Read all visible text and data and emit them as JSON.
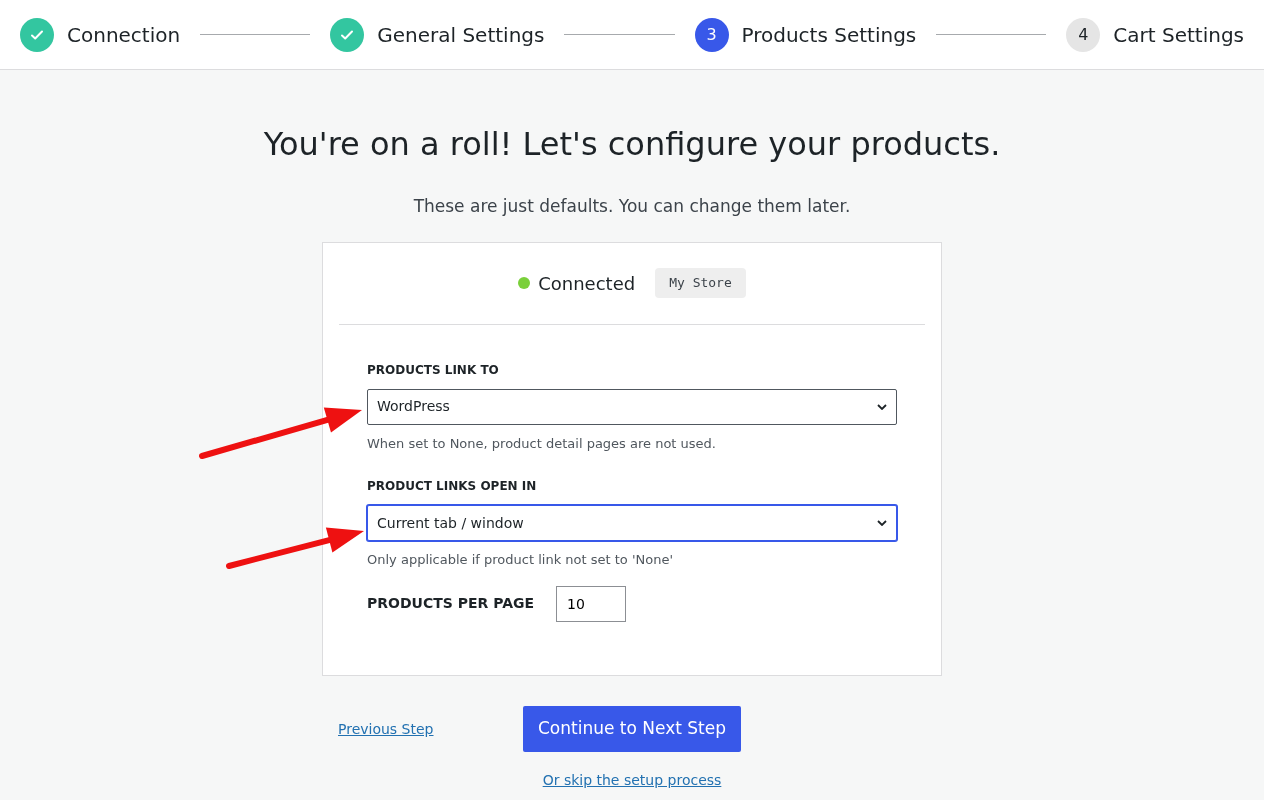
{
  "steps": [
    {
      "label": "Connection",
      "kind": "done"
    },
    {
      "label": "General Settings",
      "kind": "done"
    },
    {
      "number": "3",
      "label": "Products Settings",
      "kind": "current"
    },
    {
      "number": "4",
      "label": "Cart Settings",
      "kind": "pending"
    }
  ],
  "heading": "You're on a roll! Let's configure your products.",
  "subheading": "These are just defaults. You can change them later.",
  "status": {
    "color": "#7ad03a",
    "label": "Connected",
    "store": "My Store"
  },
  "fields": [
    {
      "label": "PRODUCTS LINK TO",
      "value": "WordPress",
      "help": "When set to None, product detail pages are not used.",
      "focused": false,
      "annotated": true
    },
    {
      "label": "PRODUCT LINKS OPEN IN",
      "value": "Current tab / window",
      "help": "Only applicable if product link not set to 'None'",
      "focused": true,
      "annotated": true
    }
  ],
  "per_page": {
    "label": "PRODUCTS PER PAGE",
    "value": "10"
  },
  "previous_link": "Previous Step",
  "next_button": "Continue to Next Step",
  "skip_link": "Or skip the setup process"
}
